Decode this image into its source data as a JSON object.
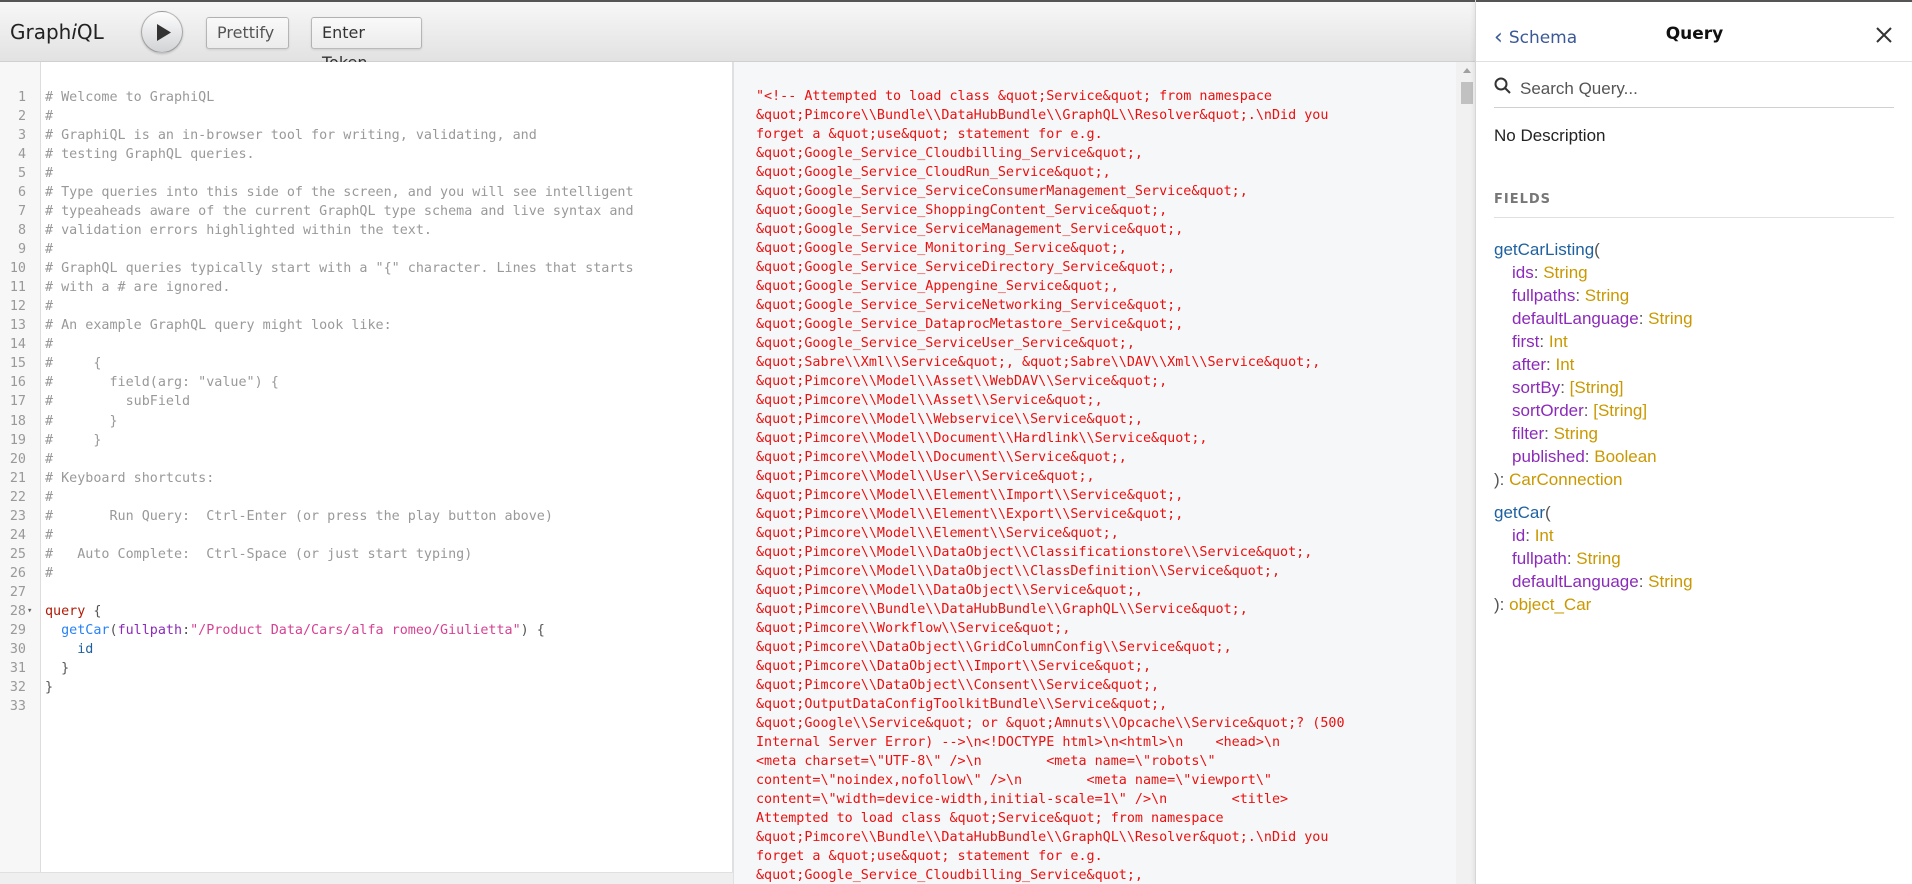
{
  "toolbar": {
    "logo_prefix": "Graph",
    "logo_italic": "i",
    "logo_suffix": "QL",
    "prettify_label": "Prettify",
    "token_label": "Enter Token"
  },
  "editor": {
    "lines": [
      {
        "n": "1",
        "t": "# Welcome to GraphiQL"
      },
      {
        "n": "2",
        "t": "#"
      },
      {
        "n": "3",
        "t": "# GraphiQL is an in-browser tool for writing, validating, and"
      },
      {
        "n": "4",
        "t": "# testing GraphQL queries."
      },
      {
        "n": "5",
        "t": "#"
      },
      {
        "n": "6",
        "t": "# Type queries into this side of the screen, and you will see intelligent"
      },
      {
        "n": "7",
        "t": "# typeaheads aware of the current GraphQL type schema and live syntax and"
      },
      {
        "n": "8",
        "t": "# validation errors highlighted within the text."
      },
      {
        "n": "9",
        "t": "#"
      },
      {
        "n": "10",
        "t": "# GraphQL queries typically start with a \"{\" character. Lines that starts"
      },
      {
        "n": "11",
        "t": "# with a # are ignored."
      },
      {
        "n": "12",
        "t": "#"
      },
      {
        "n": "13",
        "t": "# An example GraphQL query might look like:"
      },
      {
        "n": "14",
        "t": "#"
      },
      {
        "n": "15",
        "t": "#     {"
      },
      {
        "n": "16",
        "t": "#       field(arg: \"value\") {"
      },
      {
        "n": "17",
        "t": "#         subField"
      },
      {
        "n": "18",
        "t": "#       }"
      },
      {
        "n": "19",
        "t": "#     }"
      },
      {
        "n": "20",
        "t": "#"
      },
      {
        "n": "21",
        "t": "# Keyboard shortcuts:"
      },
      {
        "n": "22",
        "t": "#"
      },
      {
        "n": "23",
        "t": "#       Run Query:  Ctrl-Enter (or press the play button above)"
      },
      {
        "n": "24",
        "t": "#"
      },
      {
        "n": "25",
        "t": "#   Auto Complete:  Ctrl-Space (or just start typing)"
      },
      {
        "n": "26",
        "t": "#"
      },
      {
        "n": "27",
        "t": ""
      },
      {
        "n": "28",
        "t": ""
      },
      {
        "n": "29",
        "t": ""
      },
      {
        "n": "30",
        "t": ""
      },
      {
        "n": "31",
        "t": ""
      },
      {
        "n": "32",
        "t": ""
      },
      {
        "n": "33",
        "t": ""
      }
    ],
    "query": {
      "keyword": "query",
      "open_brace": " {",
      "field": "getCar",
      "arg_name": "fullpath",
      "arg_value": "\"/Product Data/Cars/alfa romeo/Giulietta\"",
      "subfield": "id",
      "close_inner": "}",
      "close_outer": "}"
    }
  },
  "result": {
    "text": "\"<!-- Attempted to load class &quot;Service&quot; from namespace\n&quot;Pimcore\\\\Bundle\\\\DataHubBundle\\\\GraphQL\\\\Resolver&quot;.\\nDid you\nforget a &quot;use&quot; statement for e.g.\n&quot;Google_Service_Cloudbilling_Service&quot;,\n&quot;Google_Service_CloudRun_Service&quot;,\n&quot;Google_Service_ServiceConsumerManagement_Service&quot;,\n&quot;Google_Service_ShoppingContent_Service&quot;,\n&quot;Google_Service_ServiceManagement_Service&quot;,\n&quot;Google_Service_Monitoring_Service&quot;,\n&quot;Google_Service_ServiceDirectory_Service&quot;,\n&quot;Google_Service_Appengine_Service&quot;,\n&quot;Google_Service_ServiceNetworking_Service&quot;,\n&quot;Google_Service_DataprocMetastore_Service&quot;,\n&quot;Google_Service_ServiceUser_Service&quot;,\n&quot;Sabre\\\\Xml\\\\Service&quot;, &quot;Sabre\\\\DAV\\\\Xml\\\\Service&quot;,\n&quot;Pimcore\\\\Model\\\\Asset\\\\WebDAV\\\\Service&quot;,\n&quot;Pimcore\\\\Model\\\\Asset\\\\Service&quot;,\n&quot;Pimcore\\\\Model\\\\Webservice\\\\Service&quot;,\n&quot;Pimcore\\\\Model\\\\Document\\\\Hardlink\\\\Service&quot;,\n&quot;Pimcore\\\\Model\\\\Document\\\\Service&quot;,\n&quot;Pimcore\\\\Model\\\\User\\\\Service&quot;,\n&quot;Pimcore\\\\Model\\\\Element\\\\Import\\\\Service&quot;,\n&quot;Pimcore\\\\Model\\\\Element\\\\Export\\\\Service&quot;,\n&quot;Pimcore\\\\Model\\\\Element\\\\Service&quot;,\n&quot;Pimcore\\\\Model\\\\DataObject\\\\Classificationstore\\\\Service&quot;,\n&quot;Pimcore\\\\Model\\\\DataObject\\\\ClassDefinition\\\\Service&quot;,\n&quot;Pimcore\\\\Model\\\\DataObject\\\\Service&quot;,\n&quot;Pimcore\\\\Bundle\\\\DataHubBundle\\\\GraphQL\\\\Service&quot;,\n&quot;Pimcore\\\\Workflow\\\\Service&quot;,\n&quot;Pimcore\\\\DataObject\\\\GridColumnConfig\\\\Service&quot;,\n&quot;Pimcore\\\\DataObject\\\\Import\\\\Service&quot;,\n&quot;Pimcore\\\\DataObject\\\\Consent\\\\Service&quot;,\n&quot;OutputDataConfigToolkitBundle\\\\Service&quot;,\n&quot;Google\\\\Service&quot; or &quot;Amnuts\\\\Opcache\\\\Service&quot;? (500\nInternal Server Error) -->\\n<!DOCTYPE html>\\n<html>\\n    <head>\\n\n<meta charset=\\\"UTF-8\\\" />\\n        <meta name=\\\"robots\\\"\ncontent=\\\"noindex,nofollow\\\" />\\n        <meta name=\\\"viewport\\\"\ncontent=\\\"width=device-width,initial-scale=1\\\" />\\n        <title>\nAttempted to load class &quot;Service&quot; from namespace\n&quot;Pimcore\\\\Bundle\\\\DataHubBundle\\\\GraphQL\\\\Resolver&quot;.\\nDid you\nforget a &quot;use&quot; statement for e.g.\n&quot;Google_Service_Cloudbilling_Service&quot;,"
  },
  "docs": {
    "back_label": "Schema",
    "title": "Query",
    "search_placeholder": "Search Query...",
    "description": "No Description",
    "fields_heading": "FIELDS",
    "fields": [
      {
        "name": "getCarListing",
        "args": [
          {
            "name": "ids",
            "type": "String"
          },
          {
            "name": "fullpaths",
            "type": "String"
          },
          {
            "name": "defaultLanguage",
            "type": "String"
          },
          {
            "name": "first",
            "type": "Int"
          },
          {
            "name": "after",
            "type": "Int"
          },
          {
            "name": "sortBy",
            "type": "[String]"
          },
          {
            "name": "sortOrder",
            "type": "[String]"
          },
          {
            "name": "filter",
            "type": "String"
          },
          {
            "name": "published",
            "type": "Boolean"
          }
        ],
        "return_type": "CarConnection"
      },
      {
        "name": "getCar",
        "args": [
          {
            "name": "id",
            "type": "Int"
          },
          {
            "name": "fullpath",
            "type": "String"
          },
          {
            "name": "defaultLanguage",
            "type": "String"
          }
        ],
        "return_type": "object_Car"
      }
    ]
  }
}
